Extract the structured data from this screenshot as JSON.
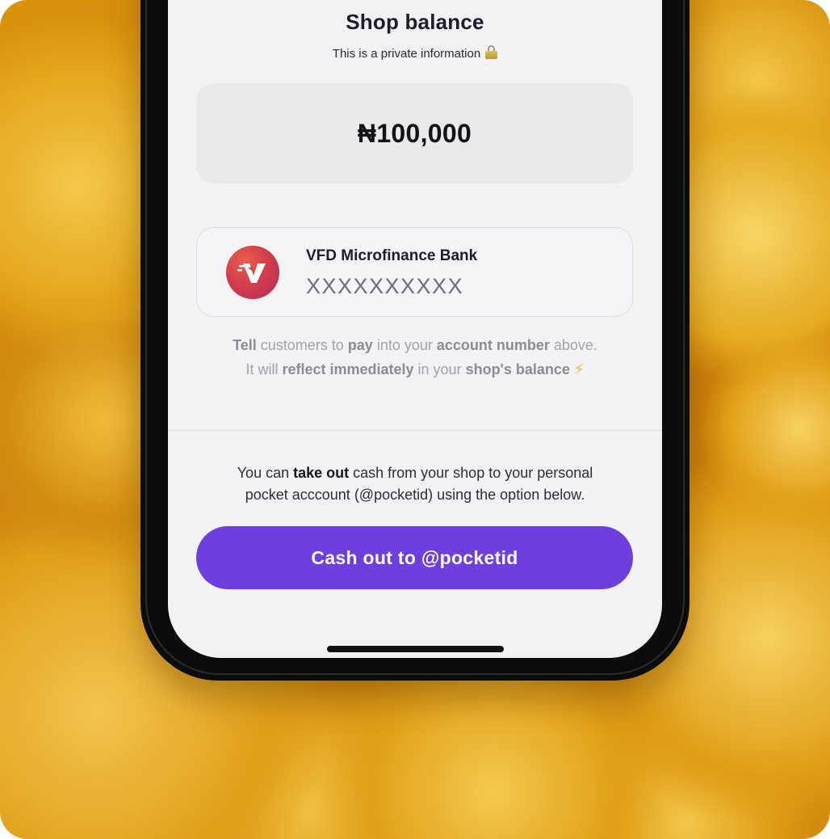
{
  "screen": {
    "title": "Shop balance",
    "subtitle": "This is a private information",
    "balance": "₦100,000"
  },
  "bank": {
    "name": "VFD Microfinance Bank",
    "account_number": "XXXXXXXXXX"
  },
  "hint": {
    "line1": [
      "Tell",
      " customers to ",
      "pay",
      " into your ",
      "account number",
      " above."
    ],
    "line2": [
      "It will ",
      "reflect immediately",
      " in your ",
      "shop's balance",
      " ⚡"
    ]
  },
  "cashout": {
    "note_line1": [
      "You can ",
      "take out",
      " cash from your shop to your personal"
    ],
    "note_line2": "pocket acccount (@pocketid) using the option below.",
    "button_label": "Cash out to @pocketid"
  },
  "colors": {
    "accent": "#6d3fe0",
    "screen_bg": "#f2f2f4",
    "background": "#e0a118"
  }
}
